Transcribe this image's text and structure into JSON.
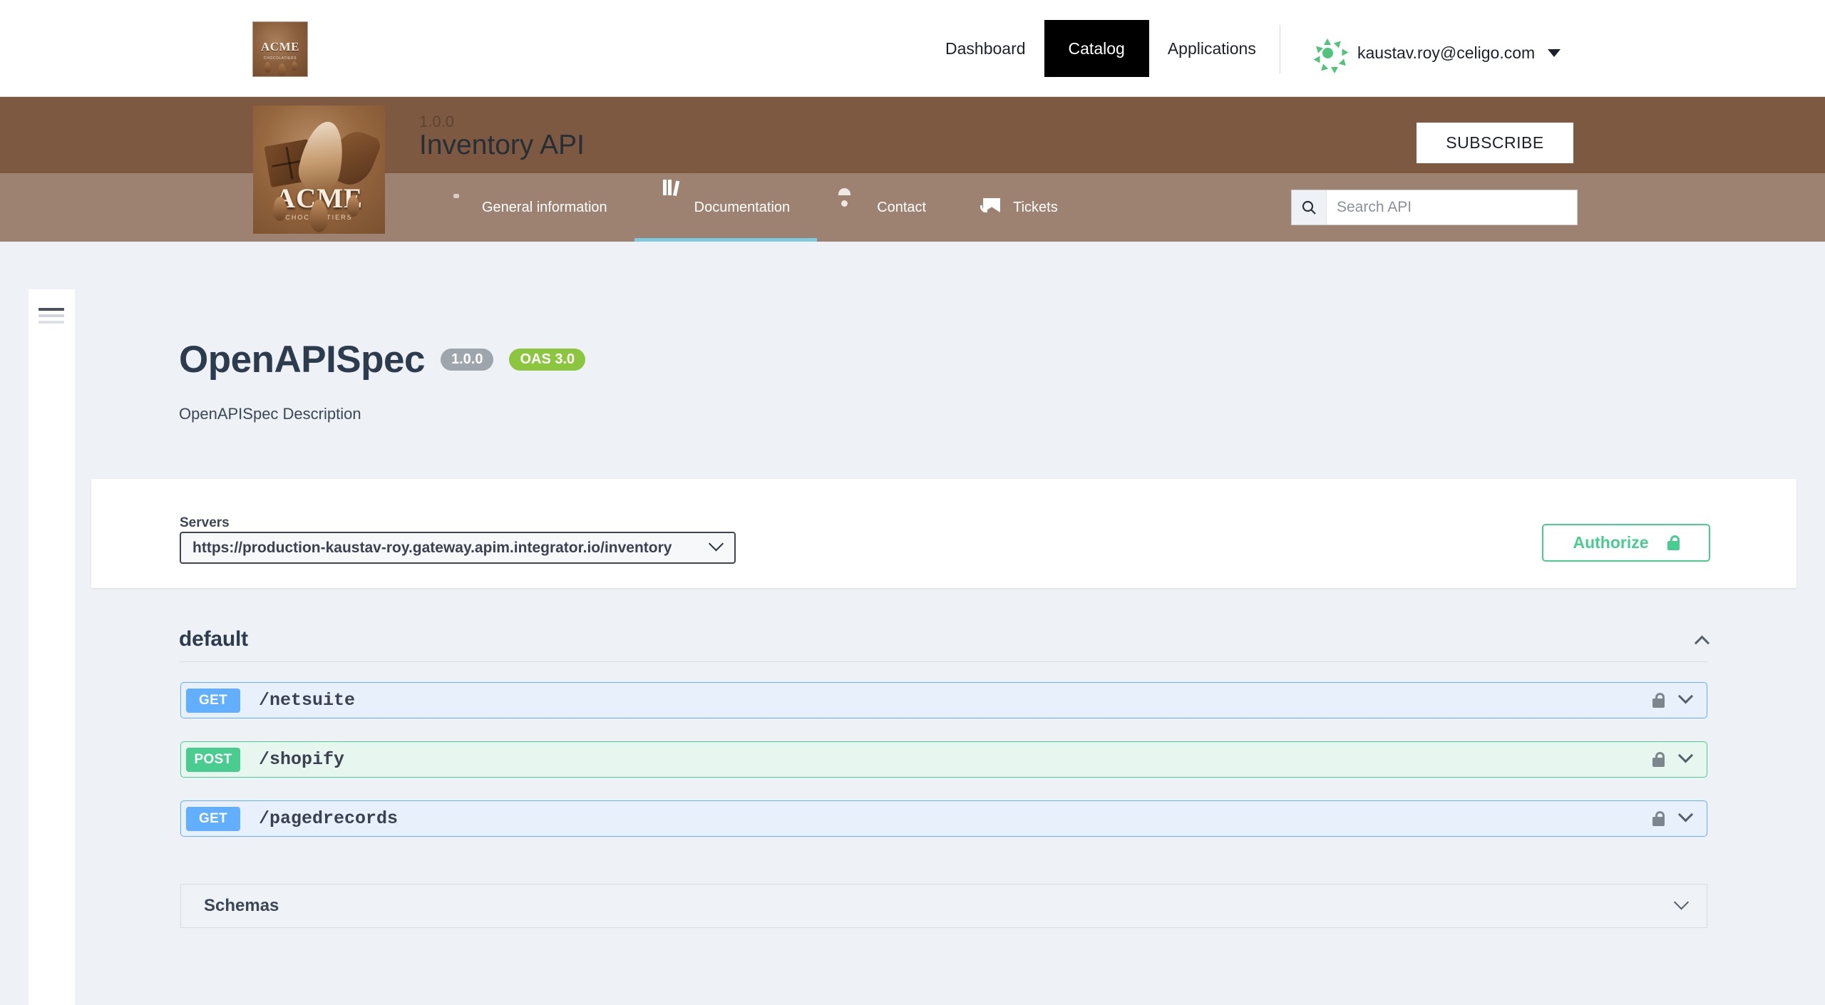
{
  "topnav": {
    "logo_alt": "ACME Chocolatiers",
    "logo_word": "ACME",
    "logo_sub": "CHOCOLATIERS",
    "links": [
      {
        "label": "Dashboard",
        "active": false
      },
      {
        "label": "Catalog",
        "active": true
      },
      {
        "label": "Applications",
        "active": false
      }
    ],
    "user_email": "kaustav.roy@celigo.com"
  },
  "api_header": {
    "version": "1.0.0",
    "title": "Inventory API",
    "subscribe_label": "SUBSCRIBE",
    "logo_word": "ACME",
    "logo_sub": "CHOCOLATIERS",
    "tabs": [
      {
        "label": "General information",
        "icon": "clipboard-icon",
        "active": false
      },
      {
        "label": "Documentation",
        "icon": "books-icon",
        "active": true
      },
      {
        "label": "Contact",
        "icon": "person-icon",
        "active": false
      },
      {
        "label": "Tickets",
        "icon": "envelope-icon",
        "active": false
      }
    ],
    "search": {
      "placeholder": "Search API",
      "value": "",
      "icon": "search-icon"
    }
  },
  "spec": {
    "title": "OpenAPISpec",
    "version_badge": "1.0.0",
    "oas_badge": "OAS 3.0",
    "description": "OpenAPISpec Description",
    "servers_label": "Servers",
    "server_selected": "https://production-kaustav-roy.gateway.apim.integrator.io/inventory",
    "authorize_label": "Authorize",
    "section_name": "default",
    "operations": [
      {
        "method": "GET",
        "path": "/netsuite",
        "style": "get"
      },
      {
        "method": "POST",
        "path": "/shopify",
        "style": "post"
      },
      {
        "method": "GET",
        "path": "/pagedrecords",
        "style": "get"
      }
    ],
    "schemas_label": "Schemas"
  },
  "colors": {
    "brand_brown": "#7d5942",
    "brand_brown_light": "#9d8271",
    "accent_cyan": "#7ecbe0",
    "get_blue": "#61affe",
    "post_green": "#49cc90",
    "oas_green": "#8cc63f",
    "page_bg": "#eef2f6"
  }
}
